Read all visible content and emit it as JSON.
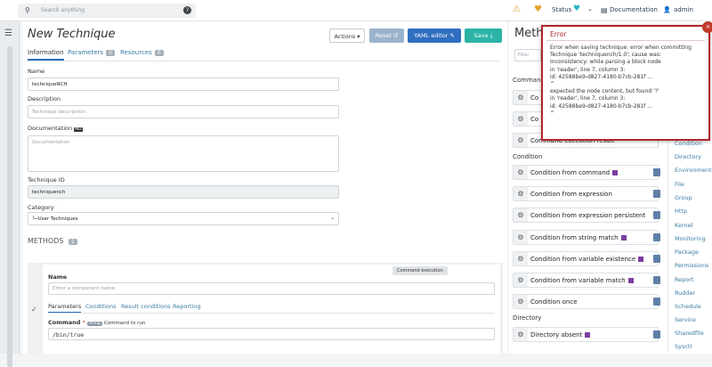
{
  "topbar": {
    "search_placeholder": "Search anything",
    "help": "?",
    "status_label": "Status",
    "documentation": "Documentation",
    "user": "admin"
  },
  "page": {
    "title": "New Technique"
  },
  "actions": {
    "actions_label": "Actions",
    "reset_label": "Reset",
    "yaml_label": "YAML editor",
    "save_label": "Save"
  },
  "tabs": [
    {
      "label": "Information"
    },
    {
      "label": "Parameters",
      "count": "0"
    },
    {
      "label": "Resources",
      "count": "0"
    }
  ],
  "form": {
    "name_label": "Name",
    "name_value": "techniqueNCH",
    "description_label": "Description",
    "description_placeholder": "Technique description",
    "documentation_label": "Documentation",
    "documentation_badge": "MD",
    "documentation_placeholder": "Documentation",
    "technique_id_label": "Technique ID",
    "technique_id_value": "techniquench",
    "category_label": "Category",
    "category_value": "└─User Techniques"
  },
  "methods": {
    "header": "METHODS",
    "count": "1"
  },
  "method_card": {
    "tooltip": "Command execution",
    "name_label": "Name",
    "name_placeholder": "Enter a component name",
    "tabs": [
      "Parameters",
      "Conditions",
      "Result conditions",
      "Reporting"
    ],
    "command_label": "Command",
    "required_mark": "*",
    "type_badge": "string",
    "command_hint": "Command to run",
    "command_value": "/bin/true"
  },
  "side": {
    "title": "Meth",
    "filter_placeholder": "Filter",
    "section_command": "Command",
    "section_condition": "Condition",
    "section_directory": "Directory",
    "command_rows": [
      "Co",
      "Co",
      "Command execution result"
    ],
    "condition_rows": [
      {
        "name": "Condition from command",
        "windows": true
      },
      {
        "name": "Condition from expression",
        "windows": false
      },
      {
        "name": "Condition from expression persistent",
        "windows": false
      },
      {
        "name": "Condition from string match",
        "windows": true
      },
      {
        "name": "Condition from variable existence",
        "windows": true
      },
      {
        "name": "Condition from variable match",
        "windows": true
      },
      {
        "name": "Condition once",
        "windows": false
      }
    ],
    "directory_rows": [
      {
        "name": "Directory absent",
        "windows": true
      }
    ],
    "links": [
      "Condition",
      "Directory",
      "Environment",
      "File",
      "Group",
      "Http",
      "Kernel",
      "Monitoring",
      "Package",
      "Permissions",
      "Report",
      "Rudder",
      "Schedule",
      "Service",
      "Sharedfile",
      "Sysctl"
    ]
  },
  "error": {
    "title": "Error",
    "close": "×",
    "message": "Error when saving technique: error when committing\nTechnique 'techniquench/1.0'; cause was:\nInconsistency: while parsing a block node\nin 'reader', line 7, column 3:\nid: 42588be9-d827-4180-b7cb-281f ...\n^\nexpected the node content, but found '?'\nin 'reader', line 7, column 3:\nid: 42588be9-d827-4180-b7cb-281f ...\n^"
  }
}
